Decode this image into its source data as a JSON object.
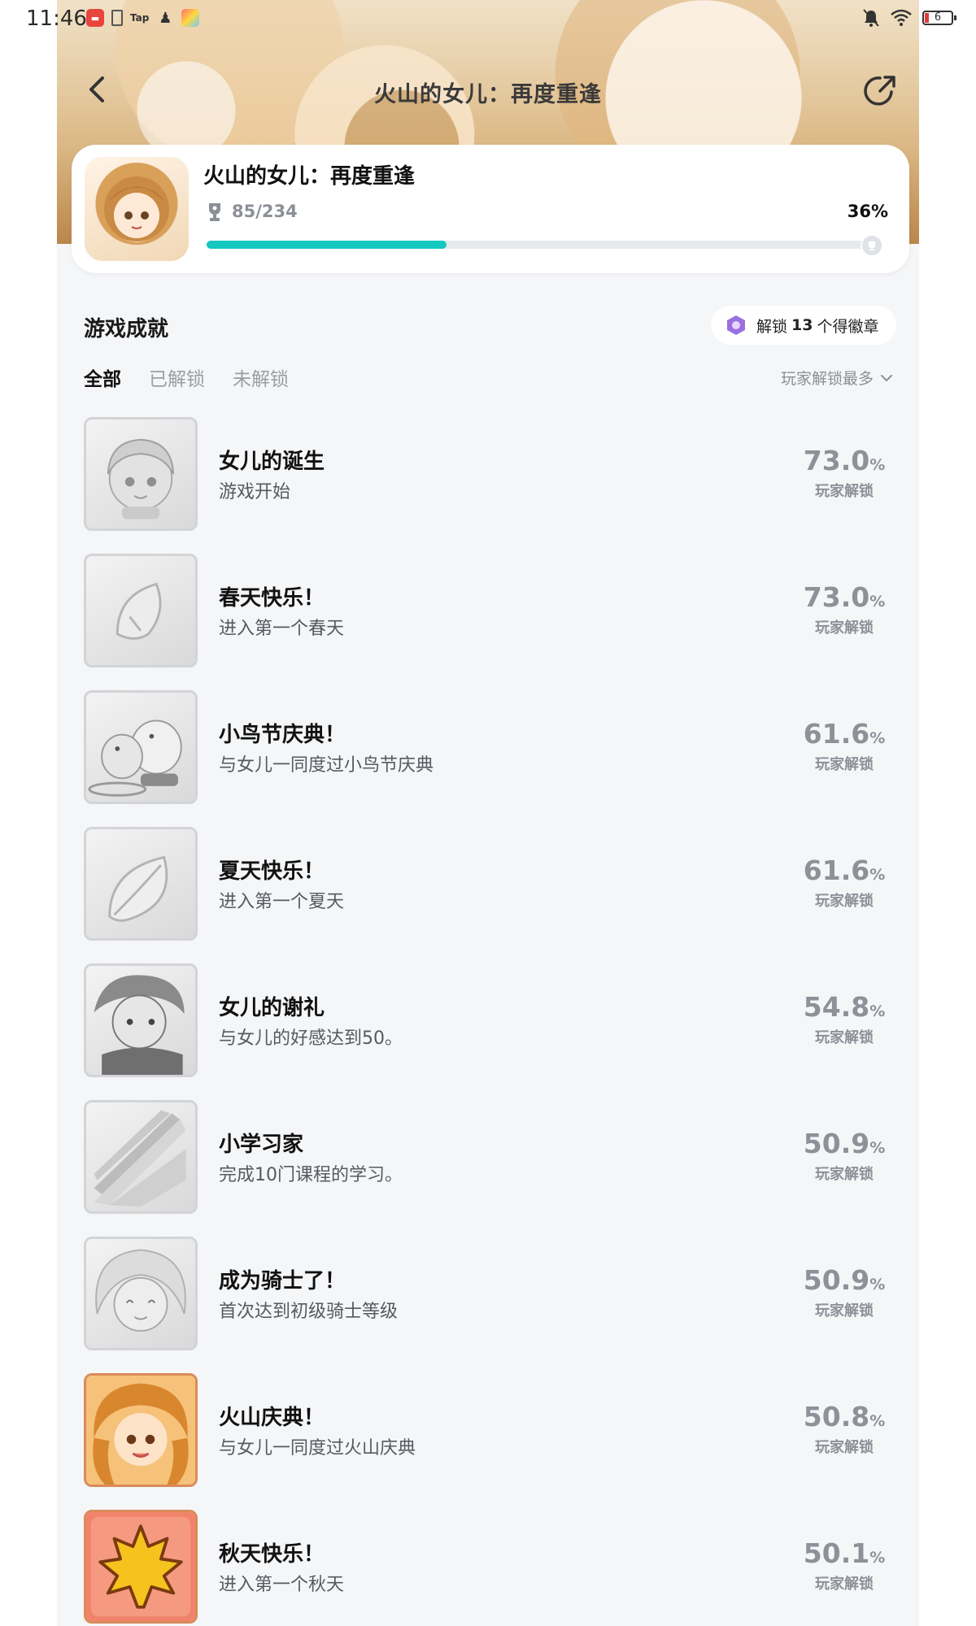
{
  "status_bar": {
    "time": "11:46",
    "battery_level": "6"
  },
  "nav": {
    "title": "火山的女儿：再度重逢"
  },
  "game": {
    "name": "火山的女儿：再度重逢",
    "trophy_progress": "85/234",
    "percent_text": "36%",
    "progress_fraction": 0.36
  },
  "section": {
    "title": "游戏成就",
    "badge_prefix": "解锁",
    "badge_count": "13",
    "badge_suffix": "个得徽章"
  },
  "tabs": [
    {
      "label": "全部",
      "active": true
    },
    {
      "label": "已解锁",
      "active": false
    },
    {
      "label": "未解锁",
      "active": false
    }
  ],
  "sort": {
    "label": "玩家解锁最多"
  },
  "unlock_label": "玩家解锁",
  "achievements": [
    {
      "title": "女儿的诞生",
      "desc": "游戏开始",
      "pct": "73.0",
      "icon": "baby-face-icon",
      "unlocked": false
    },
    {
      "title": "春天快乐！",
      "desc": "进入第一个春天",
      "pct": "73.0",
      "icon": "petal-icon",
      "unlocked": false
    },
    {
      "title": "小鸟节庆典！",
      "desc": "与女儿一同度过小鸟节庆典",
      "pct": "61.6",
      "icon": "birds-icon",
      "unlocked": false
    },
    {
      "title": "夏天快乐！",
      "desc": "进入第一个夏天",
      "pct": "61.6",
      "icon": "leaf-icon",
      "unlocked": false
    },
    {
      "title": "女儿的谢礼",
      "desc": "与女儿的好感达到50。",
      "pct": "54.8",
      "icon": "boy-face-icon",
      "unlocked": false
    },
    {
      "title": "小学习家",
      "desc": "完成10门课程的学习。",
      "pct": "50.9",
      "icon": "book-pages-icon",
      "unlocked": false
    },
    {
      "title": "成为骑士了！",
      "desc": "首次达到初级骑士等级",
      "pct": "50.9",
      "icon": "knight-face-icon",
      "unlocked": false
    },
    {
      "title": "火山庆典！",
      "desc": "与女儿一同度过火山庆典",
      "pct": "50.8",
      "icon": "girl-portrait-icon",
      "unlocked": true
    },
    {
      "title": "秋天快乐！",
      "desc": "进入第一个秋天",
      "pct": "50.1",
      "icon": "maple-leaf-icon",
      "unlocked": true
    }
  ]
}
